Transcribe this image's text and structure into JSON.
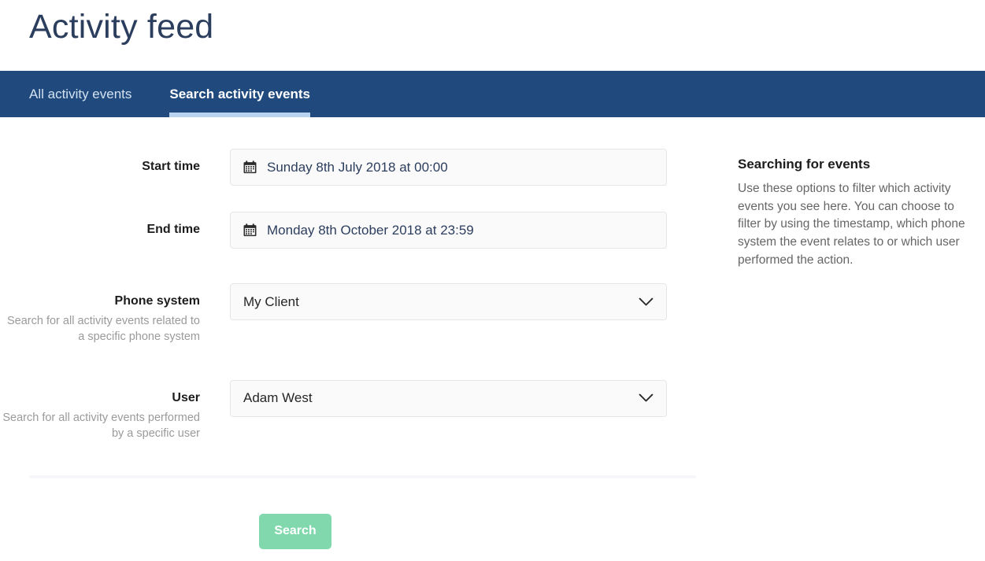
{
  "page": {
    "title": "Activity feed"
  },
  "tabs": [
    {
      "label": "All activity events",
      "active": false
    },
    {
      "label": "Search activity events",
      "active": true
    }
  ],
  "form": {
    "start_time": {
      "label": "Start time",
      "value": "Sunday 8th July 2018 at 00:00",
      "icon": "calendar-icon"
    },
    "end_time": {
      "label": "End time",
      "value": "Monday 8th October 2018 at 23:59",
      "icon": "calendar-icon"
    },
    "phone_system": {
      "label": "Phone system",
      "help": "Search for all activity events related to a specific phone system",
      "value": "My Client",
      "icon": "chevron-down-icon"
    },
    "user": {
      "label": "User",
      "help": "Search for all activity events performed by a specific user",
      "value": "Adam West",
      "icon": "chevron-down-icon"
    },
    "submit_label": "Search"
  },
  "aside": {
    "title": "Searching for events",
    "body": "Use these options to filter which activity events you see here. You can choose to filter by using the timestamp, which phone system the event relates to or which user performed the action."
  },
  "colors": {
    "nav_background": "#204a7d",
    "active_tab_underline": "#b8d3f0",
    "title_text": "#2c3e5d",
    "button_green": "#82d8ad",
    "input_background": "#fafafa",
    "input_border": "#e6e6e6",
    "help_text": "#9a9a9a",
    "divider": "#f7f7fb"
  }
}
